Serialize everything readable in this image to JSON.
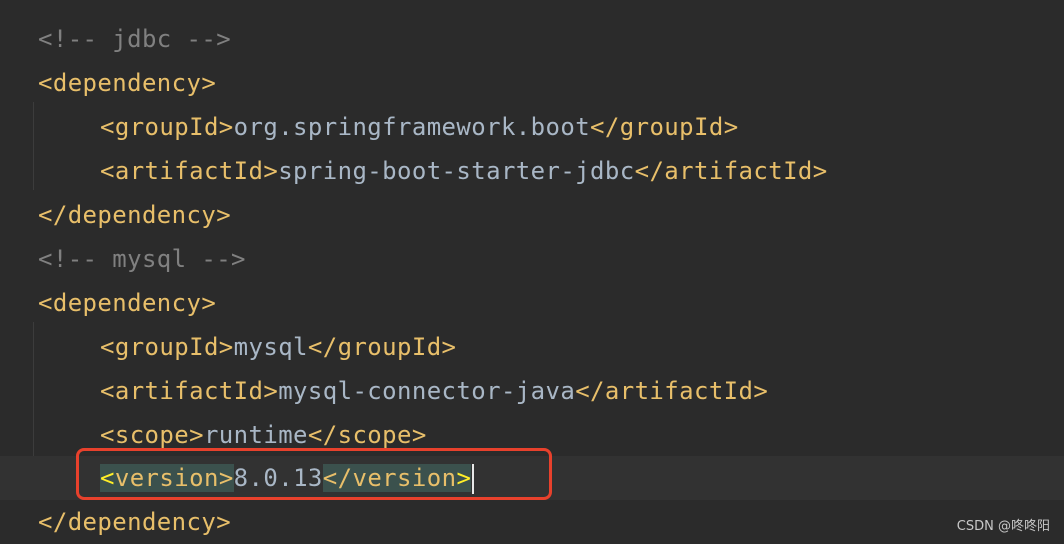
{
  "editor": {
    "lines": [
      {
        "comment": "<!-- jdbc -->"
      },
      {
        "open": "<dependency>"
      },
      {
        "tag_open": "<groupId>",
        "value": "org.springframework.boot",
        "tag_close": "</groupId>"
      },
      {
        "tag_open": "<artifactId>",
        "value": "spring-boot-starter-jdbc",
        "tag_close": "</artifactId>"
      },
      {
        "close": "</dependency>"
      },
      {
        "comment": "<!-- mysql -->"
      },
      {
        "open": "<dependency>"
      },
      {
        "tag_open": "<groupId>",
        "value": "mysql",
        "tag_close": "</groupId>"
      },
      {
        "tag_open": "<artifactId>",
        "value": "mysql-connector-java",
        "tag_close": "</artifactId>"
      },
      {
        "tag_open": "<scope>",
        "value": "runtime",
        "tag_close": "</scope>"
      },
      {
        "tag_open_lt": "<",
        "tag_open_name": "version",
        "tag_open_gt": ">",
        "value": "8.0.13",
        "tag_close_lt": "</",
        "tag_close_name": "version",
        "tag_close_gt": ">"
      },
      {
        "close": "</dependency>"
      }
    ]
  },
  "watermark": "CSDN @咚咚阳",
  "colors": {
    "background": "#2b2b2b",
    "tag": "#e8bf6a",
    "comment": "#808080",
    "text": "#a9b7c6",
    "highlight_box": "#e8412c",
    "current_line": "#323232"
  }
}
